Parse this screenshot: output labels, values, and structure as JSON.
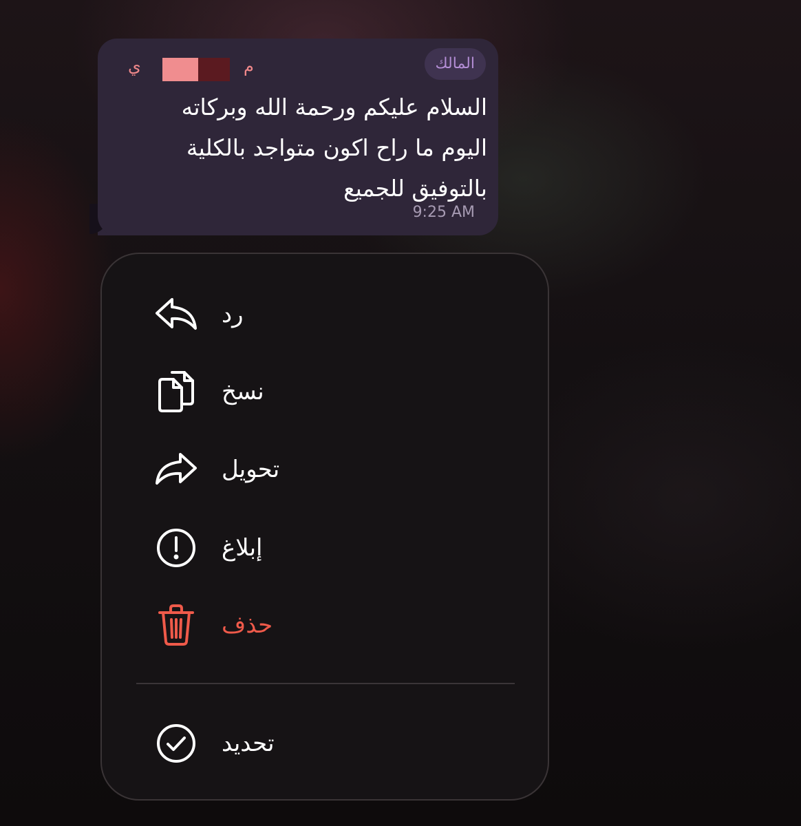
{
  "message": {
    "owner_badge": "المالك",
    "sender_name_start": "م",
    "sender_name_end": "ي",
    "lines": [
      "السلام عليكم ورحمة الله وبركاته",
      "اليوم ما راح اكون متواجد بالكلية",
      "بالتوفيق للجميع"
    ],
    "timestamp": "9:25 AM"
  },
  "menu": {
    "items": [
      {
        "label": "رد",
        "icon": "reply-icon"
      },
      {
        "label": "نسخ",
        "icon": "copy-icon"
      },
      {
        "label": "تحويل",
        "icon": "forward-icon"
      },
      {
        "label": "إبلاغ",
        "icon": "report-icon"
      },
      {
        "label": "حذف",
        "icon": "trash-icon"
      },
      {
        "label": "تحديد",
        "icon": "checkmark-circle-icon"
      }
    ]
  },
  "colors": {
    "bubble_background": "#2f2639",
    "owner_badge_text": "#b48ed6",
    "sender_name": "#f0888a",
    "menu_background": "#161315",
    "danger": "#ef5a4a",
    "text": "#ffffff"
  }
}
